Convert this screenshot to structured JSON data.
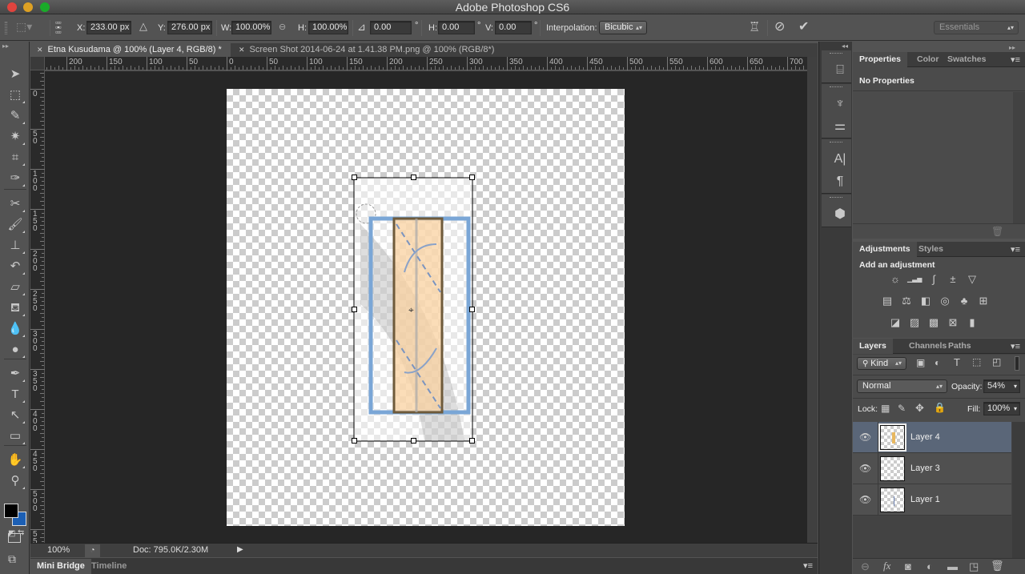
{
  "app": {
    "title": "Adobe Photoshop CS6"
  },
  "window_controls": {
    "close_color": "#e0443e",
    "minimize_color": "#dea123",
    "zoom_color": "#1aab29"
  },
  "options_bar": {
    "x_label": "X:",
    "x_value": "233.00 px",
    "y_label": "Y:",
    "y_value": "276.00 px",
    "w_label": "W:",
    "w_value": "100.00%",
    "h_label": "H:",
    "h_value": "100.00%",
    "angle_value": "0.00",
    "degree": "°",
    "hskew_label": "H:",
    "hskew_value": "0.00",
    "vskew_label": "V:",
    "vskew_value": "0.00",
    "interp_label": "Interpolation:",
    "interp_value": "Bicubic",
    "workspace_value": "Essentials"
  },
  "toolbox": {
    "tools": [
      {
        "name": "move-tool",
        "glyph": "➤"
      },
      {
        "name": "marquee-tool",
        "glyph": "⬚"
      },
      {
        "name": "lasso-tool",
        "glyph": "✎"
      },
      {
        "name": "magic-wand-tool",
        "glyph": "✷"
      },
      {
        "name": "crop-tool",
        "glyph": "⌗"
      },
      {
        "name": "eyedropper-tool",
        "glyph": "✑"
      },
      {
        "name": "healing-brush-tool",
        "glyph": "✂"
      },
      {
        "name": "brush-tool",
        "glyph": "🖌"
      },
      {
        "name": "clone-stamp-tool",
        "glyph": "⊥"
      },
      {
        "name": "history-brush-tool",
        "glyph": "↶"
      },
      {
        "name": "eraser-tool",
        "glyph": "▱"
      },
      {
        "name": "paint-bucket-tool",
        "glyph": "⛾"
      },
      {
        "name": "blur-tool",
        "glyph": "💧"
      },
      {
        "name": "dodge-tool",
        "glyph": "●"
      },
      {
        "name": "pen-tool",
        "glyph": "✒"
      },
      {
        "name": "type-tool",
        "glyph": "T"
      },
      {
        "name": "path-selection-tool",
        "glyph": "↖"
      },
      {
        "name": "rectangle-tool",
        "glyph": "▭"
      },
      {
        "name": "hand-tool",
        "glyph": "✋"
      },
      {
        "name": "zoom-tool",
        "glyph": "⚲"
      }
    ],
    "foreground_color": "#000000",
    "background_color": "#1c5fb4"
  },
  "document_tabs": [
    {
      "label": "Etna Kusudama @ 100% (Layer 4, RGB/8) *",
      "active": true
    },
    {
      "label": "Screen Shot 2014-06-24 at 1.41.38 PM.png @ 100% (RGB/8*)",
      "active": false
    }
  ],
  "rulers": {
    "horizontal": [
      "200",
      "150",
      "100",
      "50",
      "0",
      "50",
      "100",
      "150",
      "200",
      "250",
      "300",
      "350",
      "400",
      "450",
      "500",
      "550",
      "600",
      "650",
      "700"
    ],
    "vertical": [
      "0",
      "50",
      "100",
      "150",
      "200",
      "250",
      "300",
      "350",
      "400",
      "450",
      "500",
      "55"
    ]
  },
  "status_bar": {
    "zoom": "100%",
    "doc_info": "Doc: 795.0K/2.30M"
  },
  "bottom_tabs": [
    "Mini Bridge",
    "Timeline"
  ],
  "properties_panel": {
    "tabs": [
      "Properties",
      "Color",
      "Swatches"
    ],
    "content": "No Properties"
  },
  "adjustments_panel": {
    "tabs": [
      "Adjustments",
      "Styles"
    ],
    "heading": "Add an adjustment",
    "rows": [
      [
        {
          "name": "brightness-contrast-icon",
          "glyph": "☼"
        },
        {
          "name": "levels-icon",
          "glyph": "▁▃▅"
        },
        {
          "name": "curves-icon",
          "glyph": "∫"
        },
        {
          "name": "exposure-icon",
          "glyph": "±"
        },
        {
          "name": "vibrance-icon",
          "glyph": "▽"
        }
      ],
      [
        {
          "name": "hue-saturation-icon",
          "glyph": "▤"
        },
        {
          "name": "color-balance-icon",
          "glyph": "⚖"
        },
        {
          "name": "black-white-icon",
          "glyph": "◧"
        },
        {
          "name": "photo-filter-icon",
          "glyph": "◎"
        },
        {
          "name": "channel-mixer-icon",
          "glyph": "♣"
        },
        {
          "name": "color-lookup-icon",
          "glyph": "⊞"
        }
      ],
      [
        {
          "name": "invert-icon",
          "glyph": "◪"
        },
        {
          "name": "posterize-icon",
          "glyph": "▨"
        },
        {
          "name": "threshold-icon",
          "glyph": "▩"
        },
        {
          "name": "selective-color-icon",
          "glyph": "⊠"
        },
        {
          "name": "gradient-map-icon",
          "glyph": "▮"
        }
      ]
    ]
  },
  "layers_panel": {
    "tabs": [
      "Layers",
      "Channels",
      "Paths"
    ],
    "filter_kind": "Kind",
    "blend_mode": "Normal",
    "opacity_label": "Opacity:",
    "opacity_value": "54%",
    "lock_label": "Lock:",
    "fill_label": "Fill:",
    "fill_value": "100%",
    "layers": [
      {
        "name": "Layer 4",
        "visible": true,
        "selected": true
      },
      {
        "name": "Layer 3",
        "visible": true,
        "selected": false
      },
      {
        "name": "Layer 1",
        "visible": true,
        "selected": false
      }
    ]
  }
}
